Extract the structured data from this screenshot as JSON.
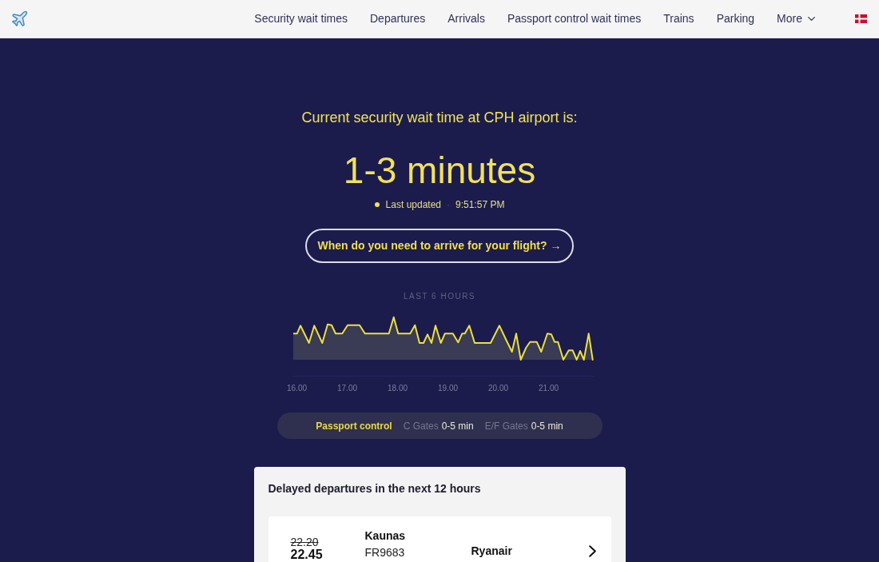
{
  "nav": {
    "items": [
      {
        "label": "Security wait times",
        "kind": "link"
      },
      {
        "label": "Departures",
        "kind": "link"
      },
      {
        "label": "Arrivals",
        "kind": "link"
      },
      {
        "label": "Passport control wait times",
        "kind": "link"
      },
      {
        "label": "Trains",
        "kind": "link"
      },
      {
        "label": "Parking",
        "kind": "link"
      },
      {
        "label": "More",
        "kind": "dropdown"
      }
    ]
  },
  "hero": {
    "heading": "Current security wait time at CPH airport is:",
    "wait_time": "1-3 minutes",
    "updated_label": "Last updated",
    "separator": "·",
    "updated_time": "9:51:57 PM",
    "cta": "When do you need to arrive for your flight? →"
  },
  "chart": {
    "title": "LAST 6 HOURS",
    "x_labels": [
      "16.00",
      "17.00",
      "18.00",
      "19.00",
      "20.00",
      "21.00"
    ]
  },
  "passport_control": {
    "label": "Passport control",
    "gates": [
      {
        "name": "C Gates",
        "wait": "0-5 min"
      },
      {
        "name": "E/F Gates",
        "wait": "0-5 min"
      }
    ]
  },
  "delayed_departures": {
    "title": "Delayed departures in the next 12 hours",
    "flights": [
      {
        "scheduled": "22.20",
        "expected": "22.45",
        "destination": "Kaunas",
        "flight_number": "FR9683",
        "airline": "Ryanair"
      }
    ]
  }
}
